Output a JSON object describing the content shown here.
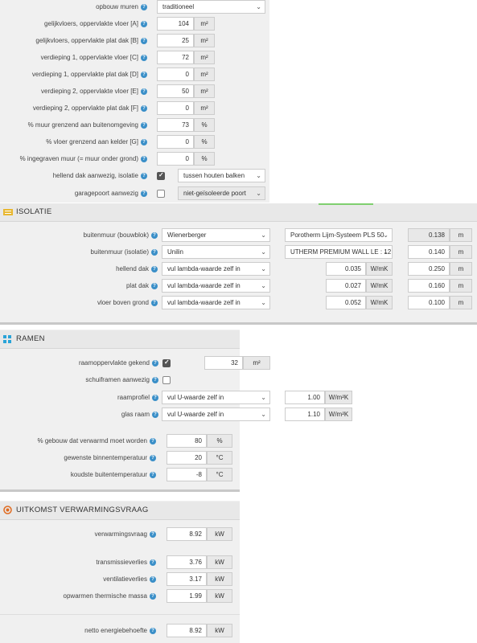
{
  "gebouw": {
    "rows": [
      {
        "label": "opbouw muren",
        "type": "select",
        "value": "traditioneel"
      },
      {
        "label": "gelijkvloers, oppervlakte vloer [A]",
        "value": "104",
        "unit": "m²"
      },
      {
        "label": "gelijkvloers, oppervlakte plat dak [B]",
        "value": "25",
        "unit": "m²"
      },
      {
        "label": "verdieping 1, oppervlakte vloer [C]",
        "value": "72",
        "unit": "m²"
      },
      {
        "label": "verdieping 1, oppervlakte plat dak [D]",
        "value": "0",
        "unit": "m²"
      },
      {
        "label": "verdieping 2, oppervlakte vloer [E]",
        "value": "50",
        "unit": "m²"
      },
      {
        "label": "verdieping 2, oppervlakte plat dak [F]",
        "value": "0",
        "unit": "m²"
      },
      {
        "label": "% muur grenzend aan buitenomgeving",
        "value": "73",
        "unit": "%"
      },
      {
        "label": "% vloer grenzend aan kelder [G]",
        "value": "0",
        "unit": "%"
      },
      {
        "label": "% ingegraven muur (= muur onder grond)",
        "value": "0",
        "unit": "%"
      },
      {
        "label": "hellend dak aanwezig, isolatie",
        "checked": true,
        "option": "tussen houten balken"
      },
      {
        "label": "garagepoort aanwezig",
        "checked": false,
        "option": "niet-geïsoleerde poort"
      }
    ]
  },
  "isolatie": {
    "title": "ISOLATIE",
    "rows": [
      {
        "label": "buitenmuur (bouwblok)",
        "select1": "Wienerberger",
        "select2": "Porotherm Lijm-Systeem PLS 50",
        "value": "0.138",
        "unit": "m"
      },
      {
        "label": "buitenmuur (isolatie)",
        "select1": "Unilin",
        "select2": "UTHERM PREMIUM WALL LE : 12",
        "value": "0.140",
        "unit": "m"
      },
      {
        "label": "hellend dak",
        "select1": "vul lambda-waarde zelf in",
        "lambda": "0.035",
        "lambda_unit": "W/mK",
        "value": "0.250",
        "unit": "m"
      },
      {
        "label": "plat dak",
        "select1": "vul lambda-waarde zelf in",
        "lambda": "0.027",
        "lambda_unit": "W/mK",
        "value": "0.160",
        "unit": "m"
      },
      {
        "label": "vloer boven grond",
        "select1": "vul lambda-waarde zelf in",
        "lambda": "0.052",
        "lambda_unit": "W/mK",
        "value": "0.100",
        "unit": "m"
      }
    ]
  },
  "ramen": {
    "title": "RAMEN",
    "opp_label": "raamoppervlakte gekend",
    "opp_value": "32",
    "opp_unit": "m²",
    "schuif_label": "schuiframen aanwezig",
    "profiel_label": "raamprofiel",
    "profiel_select": "vul U-waarde zelf in",
    "profiel_value": "1.00",
    "profiel_unit": "W/m²K",
    "glas_label": "glas raam",
    "glas_select": "vul U-waarde zelf in",
    "glas_value": "1.10",
    "glas_unit": "W/m²K"
  },
  "temperatuur": {
    "rows": [
      {
        "label": "% gebouw dat verwarmd moet worden",
        "value": "80",
        "unit": "%"
      },
      {
        "label": "gewenste binnentemperatuur",
        "value": "20",
        "unit": "°C"
      },
      {
        "label": "koudste buitentemperatuur",
        "value": "-8",
        "unit": "°C"
      }
    ]
  },
  "uitkomst": {
    "title": "UITKOMST VERWARMINGSVRAAG",
    "rows": [
      {
        "label": "verwarmingsvraag",
        "value": "8.92",
        "unit": "kW"
      },
      {
        "label": "transmissieverlies",
        "value": "3.76",
        "unit": "kW"
      },
      {
        "label": "ventilatieverlies",
        "value": "3.17",
        "unit": "kW"
      },
      {
        "label": "opwarmen thermische massa",
        "value": "1.99",
        "unit": "kW"
      },
      {
        "label": "netto energiebehoefte",
        "value": "8.92",
        "unit": "kW"
      }
    ]
  },
  "help_symbol": "?",
  "colors": {
    "accent": "#3a8fc8",
    "ramen_icon": "#29a3d8",
    "uitkomst_icon": "#e06a1f",
    "isolatie_icon": "#e8b731",
    "panel": "#f0f0f0"
  }
}
